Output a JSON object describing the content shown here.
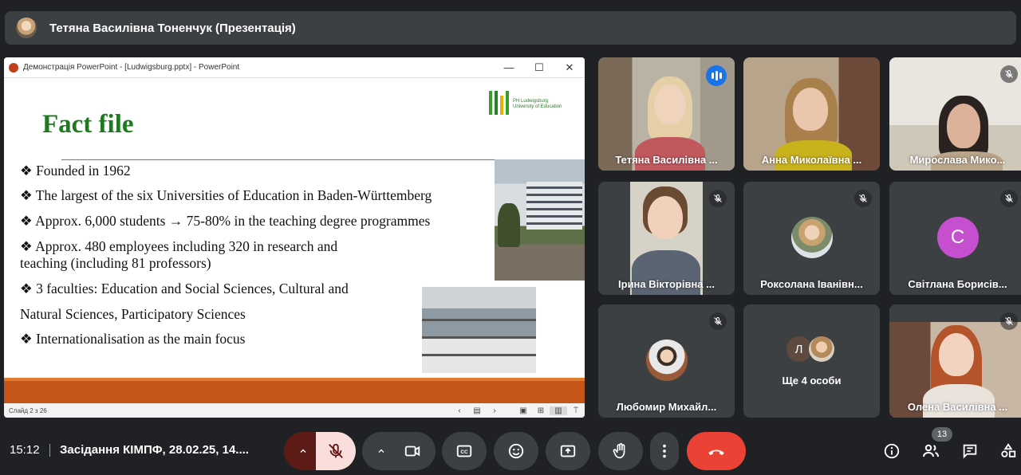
{
  "presenter_banner": {
    "title": "Тетяна Василівна Тоненчук (Презентація)"
  },
  "presentation": {
    "window_title": "Демонстрація PowerPoint - [Ludwigsburg.pptx] - PowerPoint",
    "slide": {
      "title": "Fact file",
      "logo_text_1": "PH Ludwigsburg",
      "logo_text_2": "University of Education",
      "bullets": [
        "❖ Founded in 1962",
        "❖ The largest of the six Universities of  Education in Baden-Württemberg",
        "❖ Approx. 6,000 students → 75-80% in the teaching degree programmes",
        "❖ Approx. 480 employees including 320 in research and",
        "teaching (including 81 professors)",
        "❖ 3 faculties: Education and Social Sciences, Cultural and",
        "Natural Sciences, Participatory Sciences",
        "❖ Internationalisation as the main focus"
      ]
    },
    "status": "Слайд 2 з 26"
  },
  "participants": [
    {
      "name": "Тетяна Василівна ...",
      "muted": false,
      "speaking": true
    },
    {
      "name": "Анна Миколаївна ...",
      "muted": false
    },
    {
      "name": "Мирослава Мико...",
      "muted": true
    },
    {
      "name": "Ірина Вікторівна ...",
      "muted": true
    },
    {
      "name": "Роксолана Іванівн...",
      "muted": true
    },
    {
      "name": "Світлана Борисів...",
      "muted": true,
      "initial": "С"
    },
    {
      "name": "Любомир Михайл...",
      "muted": true
    },
    {
      "name": "Олена Василівна ...",
      "muted": true
    }
  ],
  "others": {
    "initial": "Л",
    "label": "Ще 4 особи"
  },
  "bottom_bar": {
    "time": "15:12",
    "meeting_title": "Засідання КІМПФ, 28.02.25, 14....",
    "participant_count": "13"
  },
  "colors": {
    "background": "#202124",
    "tile": "#3c4043",
    "accent_blue": "#1a73e8",
    "end_call_red": "#ea4335",
    "slide_title_green": "#1e7a1e",
    "slide_bar_orange": "#c4561a"
  }
}
